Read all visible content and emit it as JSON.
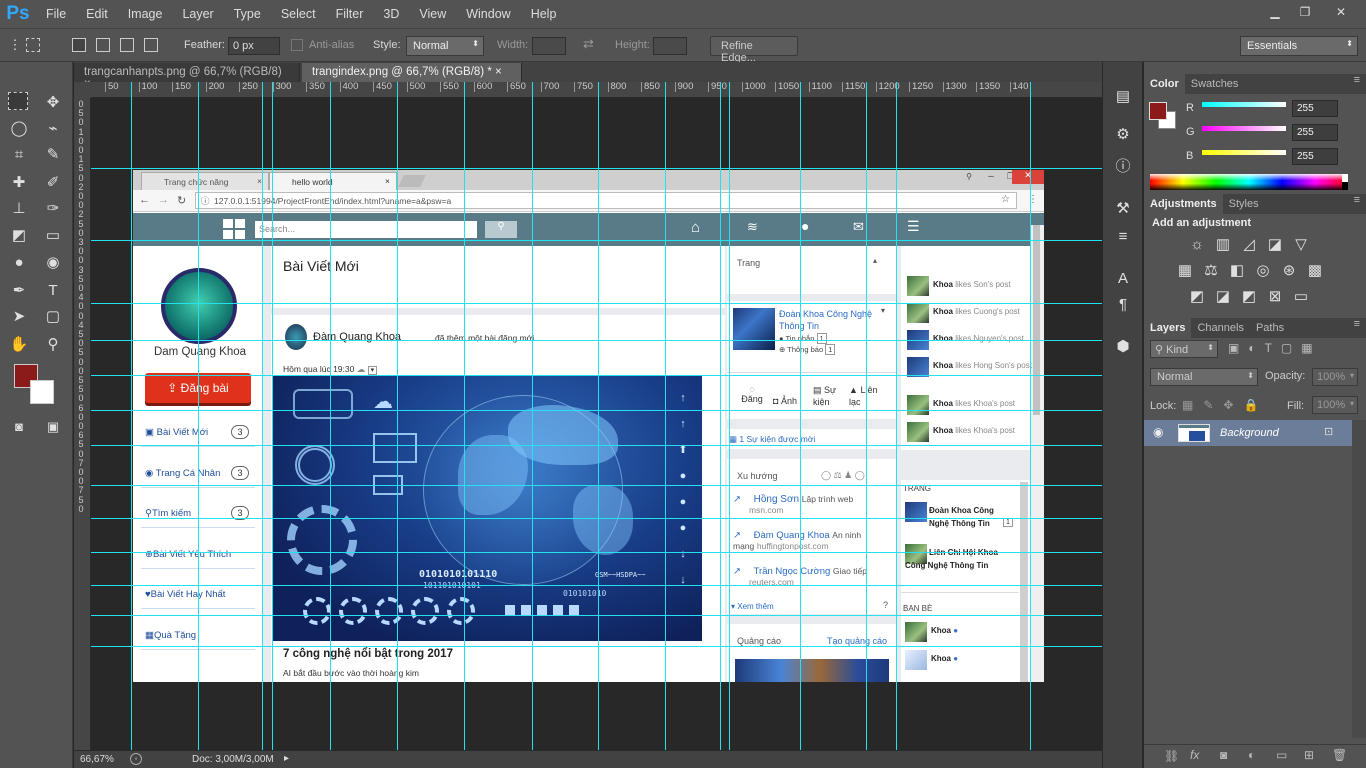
{
  "app": {
    "logo": "Ps"
  },
  "menu": [
    "File",
    "Edit",
    "Image",
    "Layer",
    "Type",
    "Select",
    "Filter",
    "3D",
    "View",
    "Window",
    "Help"
  ],
  "window_controls": {
    "minimize": "▁",
    "restore": "❐",
    "close": "✕"
  },
  "options": {
    "feather_label": "Feather:",
    "feather_value": "0 px",
    "antialias_label": "Anti-alias",
    "style_label": "Style:",
    "style_value": "Normal",
    "width_label": "Width:",
    "height_label": "Height:",
    "refine_edge": "Refine Edge...",
    "workspace": "Essentials"
  },
  "doc_tabs": [
    {
      "label": "trangcanhanpts.png @ 66,7% (RGB/8)",
      "close": "×",
      "active": false
    },
    {
      "label": "trangindex.png @ 66,7% (RGB/8) *",
      "close": "×",
      "active": true
    }
  ],
  "ruler_h": [
    "50",
    "100",
    "150",
    "200",
    "250",
    "300",
    "350",
    "400",
    "450",
    "500",
    "550",
    "600",
    "650",
    "700",
    "750",
    "800",
    "850",
    "900",
    "950",
    "1000",
    "1050",
    "1100",
    "1150",
    "1200",
    "1250",
    "1300",
    "1350",
    "140"
  ],
  "ruler_v": [
    "0",
    "5",
    "0",
    "1",
    "0",
    "0",
    "1",
    "5",
    "0",
    "2",
    "0",
    "0",
    "2",
    "5",
    "0",
    "3",
    "0",
    "0",
    "3",
    "5",
    "0",
    "4",
    "0",
    "0",
    "4",
    "5",
    "0",
    "5",
    "0",
    "0",
    "5",
    "5",
    "0",
    "6",
    "0",
    "0",
    "6",
    "5",
    "0",
    "7",
    "0",
    "0",
    "7",
    "5",
    "0"
  ],
  "status": {
    "zoom": "66,67%",
    "doc": "Doc: 3,00M/3,00M"
  },
  "color_panel": {
    "tabs": [
      "Color",
      "Swatches"
    ],
    "r_label": "R",
    "g_label": "G",
    "b_label": "B",
    "r": "255",
    "g": "255",
    "b": "255",
    "fg_color": "#8b1a1a",
    "bg_color": "#ffffff"
  },
  "adjustments": {
    "tabs": [
      "Adjustments",
      "Styles"
    ],
    "heading": "Add an adjustment"
  },
  "layers": {
    "tabs": [
      "Layers",
      "Channels",
      "Paths"
    ],
    "kind": "Kind",
    "blend": "Normal",
    "opacity_label": "Opacity:",
    "opacity": "100%",
    "lock_label": "Lock:",
    "fill_label": "Fill:",
    "fill": "100%",
    "layer_name": "Background"
  },
  "browser": {
    "tab1": "Trang chức năng",
    "tab2": "hello world",
    "url": "127.0.0.1:51994/ProjectFrontEnd/index.html?uname=a&psw=a"
  },
  "site": {
    "search_placeholder": "Search...",
    "profile_name": "Dam Quang Khoa",
    "post_button": "Đăng bài",
    "sidebar": [
      {
        "label": "Bài Viết Mới",
        "count": "3"
      },
      {
        "label": "Trang Cá Nhân",
        "count": "3"
      },
      {
        "label": "Tìm kiếm",
        "count": "3"
      },
      {
        "label": "Bài Viết Yêu Thích",
        "count": ""
      },
      {
        "label": "Bài Viết Hay Nhất",
        "count": ""
      },
      {
        "label": "Quà Tặng",
        "count": ""
      }
    ],
    "feed_title": "Bài Viết Mới",
    "post_author": "Đàm Quang Khoa",
    "post_action": "đã thêm một bài đăng mới",
    "post_time": "Hôm qua lúc 19:30",
    "post_title": "7 công nghệ nổi bật trong 2017",
    "post_sub": "AI bắt đầu bước vào thời hoàng kim",
    "image_text_1": "0101010101110",
    "image_text_2": "101101010101",
    "image_text_3": "GSM~~HSDPA~~",
    "image_text_4": "010101010",
    "col_trang": "Trang",
    "page_name": "Đoàn Khoa Công Nghệ Thông Tin",
    "page_msg": "Tin nhắn",
    "page_msg_count": "1",
    "page_notif": "Thông báo",
    "page_notif_count": "1",
    "action_post": "Đăng",
    "action_photo": "Ảnh",
    "action_event": "Sự kiện",
    "action_contact": "Liên lạc",
    "events": "1 Sự kiện được mời",
    "trending_label": "Xu hướng",
    "trending": [
      {
        "name": "Hồng Sơn",
        "topic": "Lập trình web",
        "src": "msn.com"
      },
      {
        "name": "Đàm Quang Khoa",
        "topic": "An ninh mạng",
        "src": "huffingtonpost.com"
      },
      {
        "name": "Trần Ngọc Cường",
        "topic": "Giao tiếp",
        "src": "reuters.com"
      }
    ],
    "see_more": "Xem thêm",
    "ads_label": "Quảng cáo",
    "create_ad": "Tạo quảng cáo",
    "activity": [
      {
        "who": "Khoa",
        "what": "likes Son's post"
      },
      {
        "who": "Khoa",
        "what": "likes Cuong's post"
      },
      {
        "who": "Khoa",
        "what": "likes Nguyen's post"
      },
      {
        "who": "Khoa",
        "what": "likes Hong Son's post"
      },
      {
        "who": "Khoa",
        "what": "likes Khoa's post"
      },
      {
        "who": "Khoa",
        "what": "likes Khoa's post"
      }
    ],
    "trang_header": "TRANG",
    "pages": [
      {
        "name": "Đoàn Khoa Công Nghệ Thông Tin",
        "count": "1"
      },
      {
        "name": "Liên Chi Hội Khoa Công Nghệ Thông Tin",
        "count": ""
      }
    ],
    "friends_header": "BẠN BÈ",
    "friends": [
      "Khoa",
      "Khoa"
    ]
  }
}
